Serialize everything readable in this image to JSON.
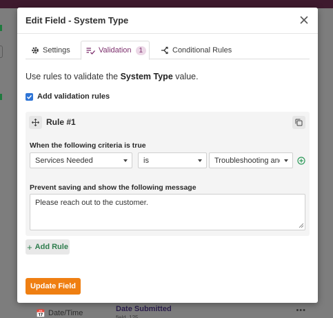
{
  "modal": {
    "title": "Edit Field - System Type",
    "tabs": [
      {
        "label": "Settings",
        "icon": "gear-icon",
        "active": false
      },
      {
        "label": "Validation",
        "icon": "list-check-icon",
        "badge": "1",
        "active": true
      },
      {
        "label": "Conditional Rules",
        "icon": "branch-icon",
        "active": false
      }
    ],
    "intro_prefix": "Use rules to validate the ",
    "intro_field": "System Type",
    "intro_suffix": " value.",
    "add_validation_label": "Add validation rules",
    "add_validation_checked": true
  },
  "rule": {
    "title": "Rule #1",
    "criteria_label": "When the following criteria is true",
    "field_select": "Services Needed",
    "operator_select": "is",
    "value_select": "Troubleshooting and Repair",
    "message_label": "Prevent saving and show the following message",
    "message_value": "Please reach out to the customer."
  },
  "actions": {
    "add_rule_label": "Add Rule",
    "update_label": "Update Field"
  },
  "background": {
    "row_type": "Date/Time",
    "row_name": "Date Submitted",
    "row_sub": "field_125",
    "row_more": "•••"
  },
  "colors": {
    "accent_purple": "#7b2d6b",
    "primary_orange": "#ef7f12",
    "add_green": "#2e7d4d",
    "checkbox_blue": "#2f75d6"
  }
}
